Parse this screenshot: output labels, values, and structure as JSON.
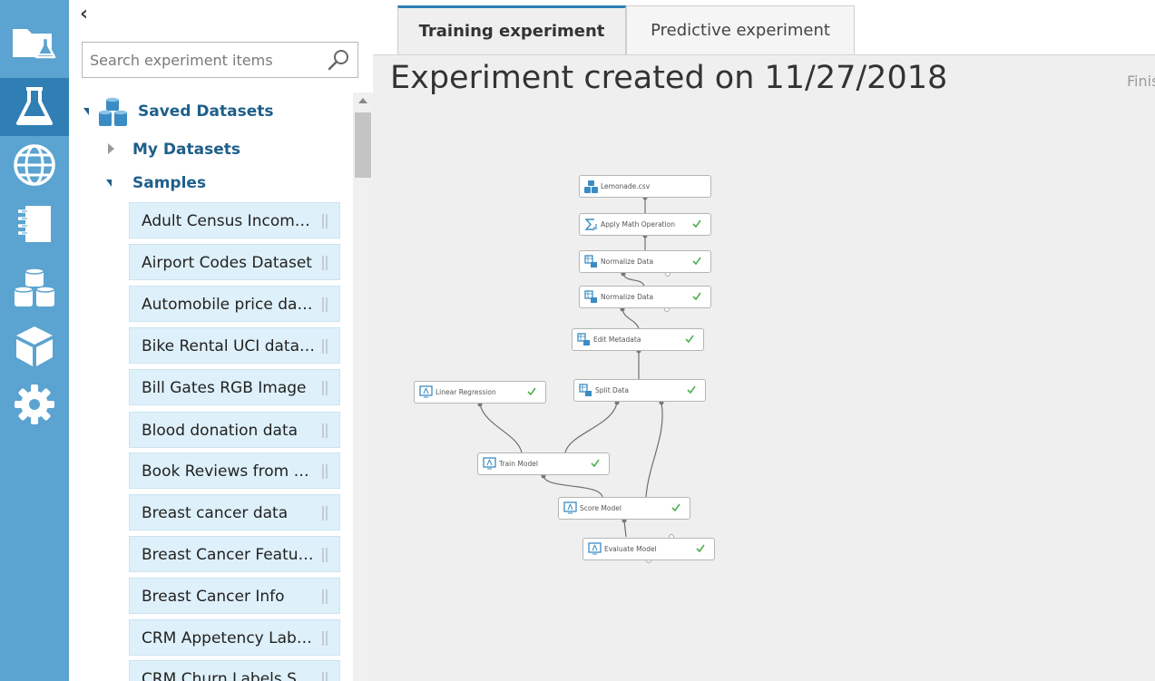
{
  "rail": {
    "items": [
      {
        "name": "projects",
        "icon": "folder-flask-icon"
      },
      {
        "name": "experiments",
        "icon": "flask-icon",
        "active": true
      },
      {
        "name": "web-services",
        "icon": "globe-icon"
      },
      {
        "name": "notebooks",
        "icon": "notebook-icon"
      },
      {
        "name": "datasets",
        "icon": "datasets-icon"
      },
      {
        "name": "trained-models",
        "icon": "cube-icon"
      },
      {
        "name": "settings",
        "icon": "gear-icon"
      }
    ]
  },
  "palette": {
    "collapse_glyph": "‹",
    "search": {
      "placeholder": "Search experiment items",
      "value": ""
    },
    "tree": {
      "saved_datasets": "Saved Datasets",
      "my_datasets": "My Datasets",
      "samples": "Samples"
    },
    "items": [
      "Adult Census Income...",
      "Airport Codes Dataset",
      "Automobile price dat...",
      "Bike Rental UCI dataset",
      "Bill Gates RGB Image",
      "Blood donation data",
      "Book Reviews from A...",
      "Breast cancer data",
      "Breast Cancer Features",
      "Breast Cancer Info",
      "CRM Appetency Labe...",
      "CRM Churn Labels Sh..."
    ]
  },
  "tabs": [
    {
      "label": "Training experiment",
      "active": true
    },
    {
      "label": "Predictive experiment",
      "active": false
    }
  ],
  "canvas": {
    "title": "Experiment created on 11/27/2018",
    "status": "Finis"
  },
  "modules": [
    {
      "id": "lemonade",
      "label": "Lemonade.csv",
      "icon": "dataset-icon",
      "status": "none"
    },
    {
      "id": "math",
      "label": "Apply Math Operation",
      "icon": "sigma-icon",
      "status": "complete"
    },
    {
      "id": "norm1",
      "label": "Normalize Data",
      "icon": "transform-icon",
      "status": "complete"
    },
    {
      "id": "norm2",
      "label": "Normalize Data",
      "icon": "transform-icon",
      "status": "complete"
    },
    {
      "id": "edit",
      "label": "Edit Metadata",
      "icon": "transform-icon",
      "status": "complete"
    },
    {
      "id": "linreg",
      "label": "Linear Regression",
      "icon": "model-icon",
      "status": "complete"
    },
    {
      "id": "split",
      "label": "Split Data",
      "icon": "transform-icon",
      "status": "complete"
    },
    {
      "id": "train",
      "label": "Train Model",
      "icon": "model-icon",
      "status": "complete"
    },
    {
      "id": "score",
      "label": "Score Model",
      "icon": "model-icon",
      "status": "complete"
    },
    {
      "id": "eval",
      "label": "Evaluate Model",
      "icon": "model-icon",
      "status": "complete"
    }
  ],
  "colors": {
    "rail": "#5ba3d0",
    "rail_active": "#2f7fb5",
    "list_item": "#def0fa",
    "tree_label": "#1f5f8b",
    "canvas": "#efefef",
    "check": "#4caf50"
  }
}
